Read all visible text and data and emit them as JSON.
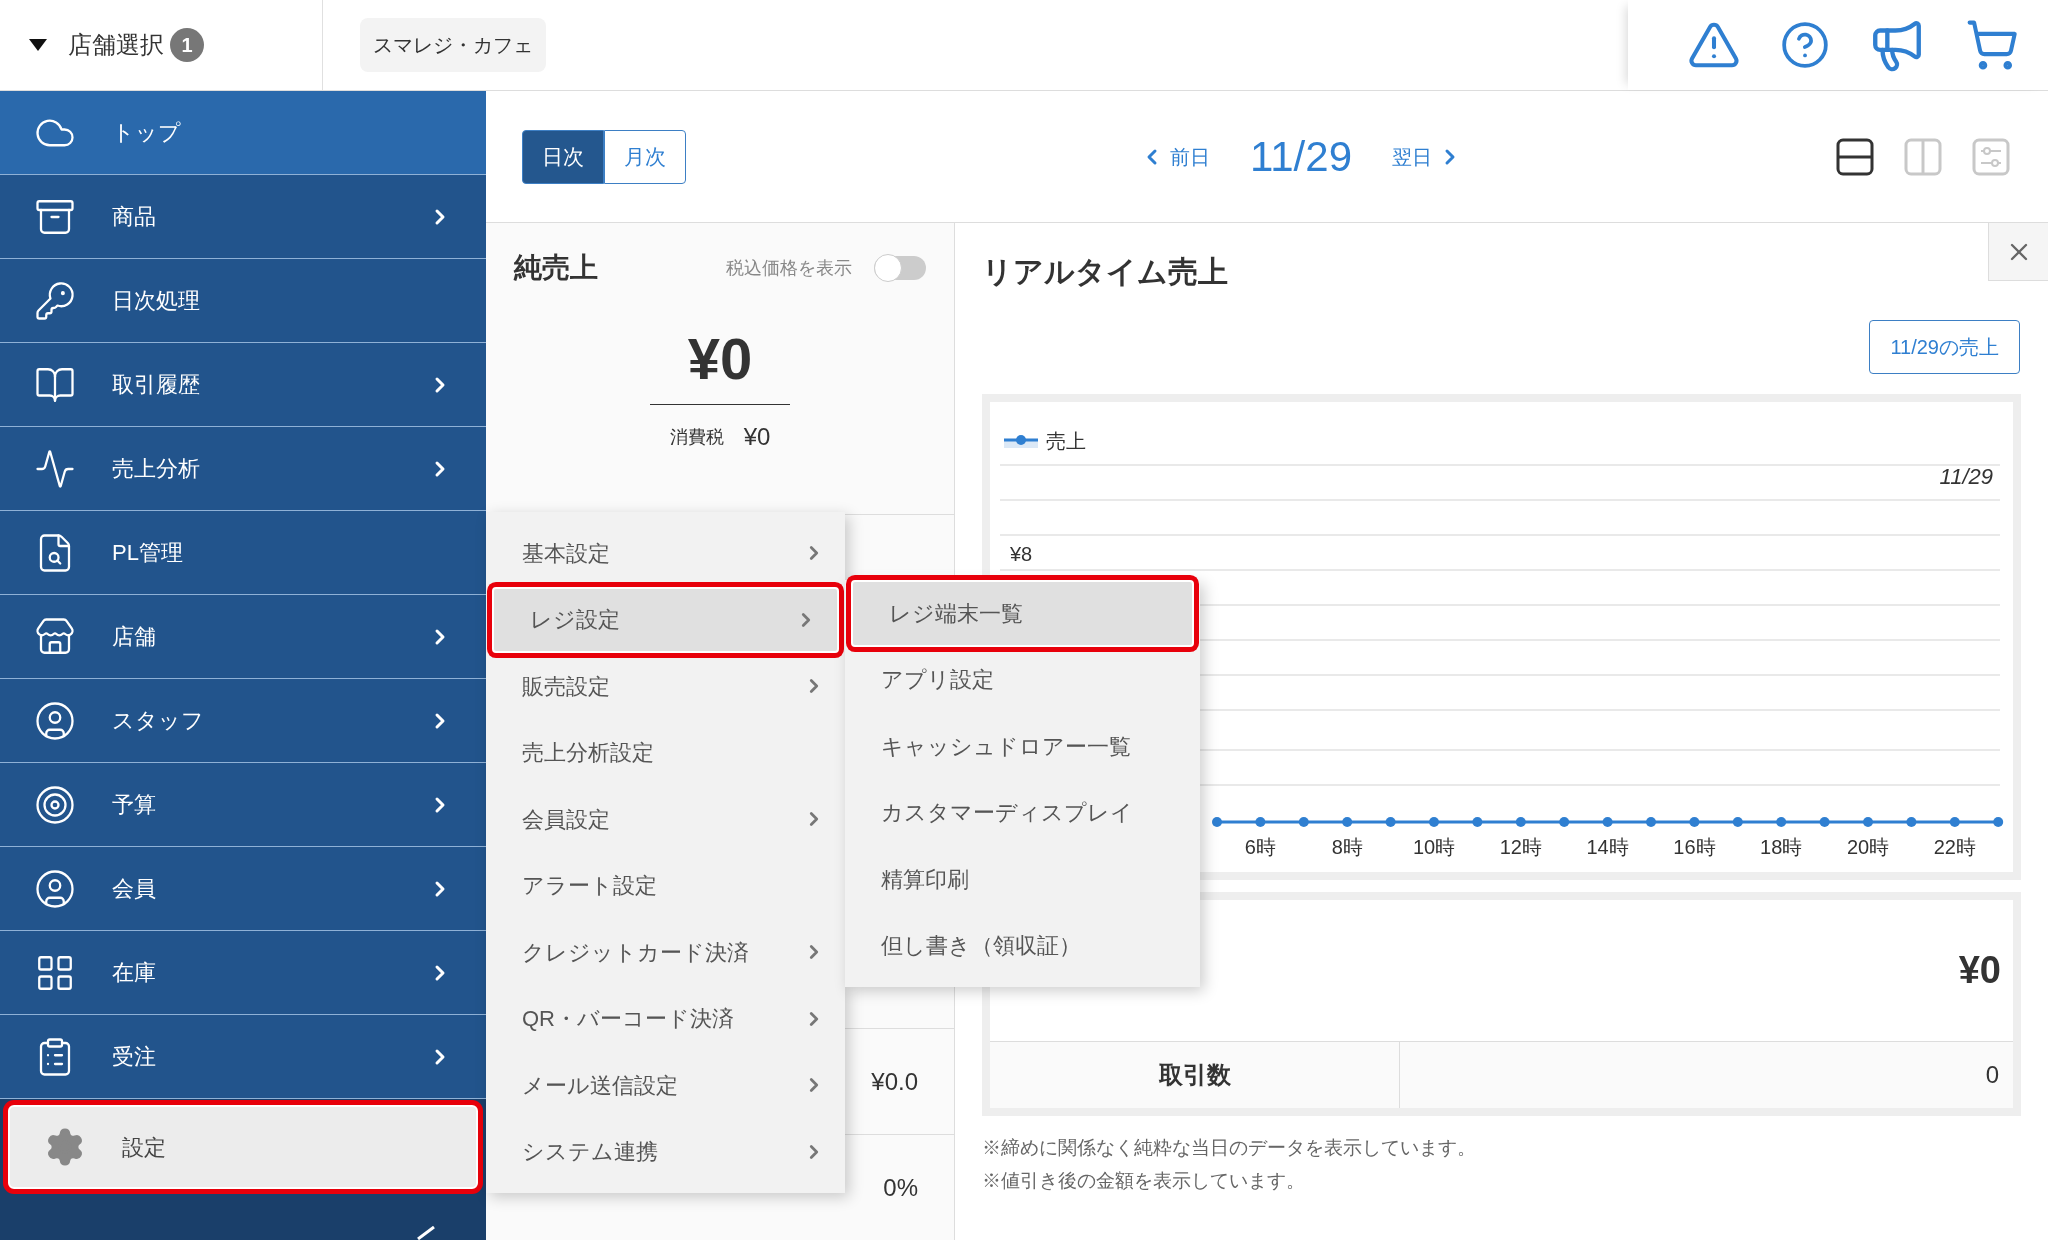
{
  "header": {
    "store_select": {
      "label": "店舗選択",
      "count": "1"
    },
    "store_chip": "スマレジ・カフェ"
  },
  "sidebar": {
    "items": [
      {
        "label": "トップ",
        "selected": true,
        "has_submenu": false,
        "highlighted": false
      },
      {
        "label": "商品",
        "selected": false,
        "has_submenu": true,
        "highlighted": false
      },
      {
        "label": "日次処理",
        "selected": false,
        "has_submenu": false,
        "highlighted": false
      },
      {
        "label": "取引履歴",
        "selected": false,
        "has_submenu": true,
        "highlighted": false
      },
      {
        "label": "売上分析",
        "selected": false,
        "has_submenu": true,
        "highlighted": false
      },
      {
        "label": "PL管理",
        "selected": false,
        "has_submenu": false,
        "highlighted": false
      },
      {
        "label": "店舗",
        "selected": false,
        "has_submenu": true,
        "highlighted": false
      },
      {
        "label": "スタッフ",
        "selected": false,
        "has_submenu": true,
        "highlighted": false
      },
      {
        "label": "予算",
        "selected": false,
        "has_submenu": true,
        "highlighted": false
      },
      {
        "label": "会員",
        "selected": false,
        "has_submenu": true,
        "highlighted": false
      },
      {
        "label": "在庫",
        "selected": false,
        "has_submenu": true,
        "highlighted": false
      },
      {
        "label": "受注",
        "selected": false,
        "has_submenu": true,
        "highlighted": false
      },
      {
        "label": "設定",
        "selected": false,
        "has_submenu": false,
        "highlighted": true
      }
    ]
  },
  "toolbar": {
    "tabs": [
      {
        "label": "日次",
        "selected": true
      },
      {
        "label": "月次",
        "selected": false
      }
    ],
    "prev": "前日",
    "date": "11/29",
    "next": "翌日",
    "view_modes": [
      {
        "selected": true
      },
      {
        "selected": false
      },
      {
        "selected": false
      }
    ]
  },
  "net_sales": {
    "title": "純売上",
    "tax_toggle": {
      "label": "税込価格を表示",
      "on": false
    },
    "amount": "¥0",
    "tax_label": "消費税",
    "tax_amount": "¥0",
    "rows": [
      "¥0.0",
      "0%"
    ]
  },
  "realtime": {
    "title": "リアルタイム売上",
    "date_button": "11/29の売上",
    "chart_date": "11/29",
    "chart": {
      "legend": "売上",
      "y_label": "¥8",
      "x_labels": [
        "6時",
        "8時",
        "10時",
        "12時",
        "14時",
        "16時",
        "18時",
        "20時",
        "22時"
      ]
    },
    "total": "¥0",
    "count_label": "取引数",
    "count": "0",
    "notes": [
      "※締めに関係なく純粋な当日のデータを表示しています。",
      "※値引き後の金額を表示しています。"
    ]
  },
  "settings_menu": {
    "items": [
      {
        "label": "基本設定",
        "has_submenu": true,
        "highlighted": false
      },
      {
        "label": "レジ設定",
        "has_submenu": true,
        "highlighted": true
      },
      {
        "label": "販売設定",
        "has_submenu": true,
        "highlighted": false
      },
      {
        "label": "売上分析設定",
        "has_submenu": false,
        "highlighted": false
      },
      {
        "label": "会員設定",
        "has_submenu": true,
        "highlighted": false
      },
      {
        "label": "アラート設定",
        "has_submenu": false,
        "highlighted": false
      },
      {
        "label": "クレジットカード決済",
        "has_submenu": true,
        "highlighted": false
      },
      {
        "label": "QR・バーコード決済",
        "has_submenu": true,
        "highlighted": false
      },
      {
        "label": "メール送信設定",
        "has_submenu": true,
        "highlighted": false
      },
      {
        "label": "システム連携",
        "has_submenu": true,
        "highlighted": false
      }
    ]
  },
  "register_submenu": {
    "items": [
      {
        "label": "レジ端末一覧",
        "highlighted": true
      },
      {
        "label": "アプリ設定",
        "highlighted": false
      },
      {
        "label": "キャッシュドロアー一覧",
        "highlighted": false
      },
      {
        "label": "カスタマーディスプレイ",
        "highlighted": false
      },
      {
        "label": "精算印刷",
        "highlighted": false
      },
      {
        "label": "但し書き（領収証）",
        "highlighted": false
      }
    ]
  }
}
